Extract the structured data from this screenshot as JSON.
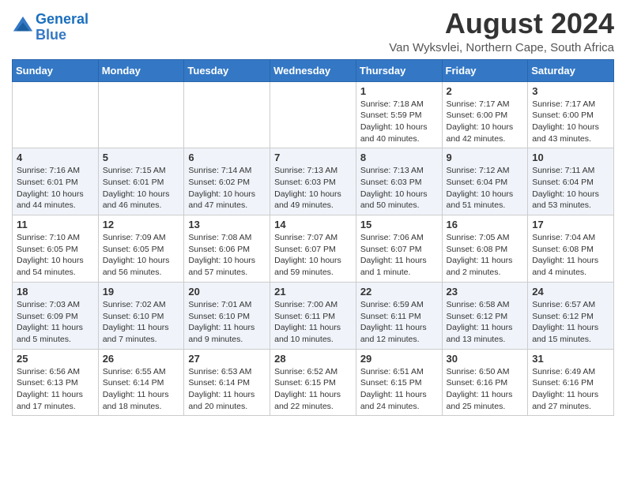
{
  "header": {
    "logo_line1": "General",
    "logo_line2": "Blue",
    "month_year": "August 2024",
    "location": "Van Wyksvlei, Northern Cape, South Africa"
  },
  "weekdays": [
    "Sunday",
    "Monday",
    "Tuesday",
    "Wednesday",
    "Thursday",
    "Friday",
    "Saturday"
  ],
  "weeks": [
    [
      {
        "day": "",
        "info": ""
      },
      {
        "day": "",
        "info": ""
      },
      {
        "day": "",
        "info": ""
      },
      {
        "day": "",
        "info": ""
      },
      {
        "day": "1",
        "info": "Sunrise: 7:18 AM\nSunset: 5:59 PM\nDaylight: 10 hours\nand 40 minutes."
      },
      {
        "day": "2",
        "info": "Sunrise: 7:17 AM\nSunset: 6:00 PM\nDaylight: 10 hours\nand 42 minutes."
      },
      {
        "day": "3",
        "info": "Sunrise: 7:17 AM\nSunset: 6:00 PM\nDaylight: 10 hours\nand 43 minutes."
      }
    ],
    [
      {
        "day": "4",
        "info": "Sunrise: 7:16 AM\nSunset: 6:01 PM\nDaylight: 10 hours\nand 44 minutes."
      },
      {
        "day": "5",
        "info": "Sunrise: 7:15 AM\nSunset: 6:01 PM\nDaylight: 10 hours\nand 46 minutes."
      },
      {
        "day": "6",
        "info": "Sunrise: 7:14 AM\nSunset: 6:02 PM\nDaylight: 10 hours\nand 47 minutes."
      },
      {
        "day": "7",
        "info": "Sunrise: 7:13 AM\nSunset: 6:03 PM\nDaylight: 10 hours\nand 49 minutes."
      },
      {
        "day": "8",
        "info": "Sunrise: 7:13 AM\nSunset: 6:03 PM\nDaylight: 10 hours\nand 50 minutes."
      },
      {
        "day": "9",
        "info": "Sunrise: 7:12 AM\nSunset: 6:04 PM\nDaylight: 10 hours\nand 51 minutes."
      },
      {
        "day": "10",
        "info": "Sunrise: 7:11 AM\nSunset: 6:04 PM\nDaylight: 10 hours\nand 53 minutes."
      }
    ],
    [
      {
        "day": "11",
        "info": "Sunrise: 7:10 AM\nSunset: 6:05 PM\nDaylight: 10 hours\nand 54 minutes."
      },
      {
        "day": "12",
        "info": "Sunrise: 7:09 AM\nSunset: 6:05 PM\nDaylight: 10 hours\nand 56 minutes."
      },
      {
        "day": "13",
        "info": "Sunrise: 7:08 AM\nSunset: 6:06 PM\nDaylight: 10 hours\nand 57 minutes."
      },
      {
        "day": "14",
        "info": "Sunrise: 7:07 AM\nSunset: 6:07 PM\nDaylight: 10 hours\nand 59 minutes."
      },
      {
        "day": "15",
        "info": "Sunrise: 7:06 AM\nSunset: 6:07 PM\nDaylight: 11 hours\nand 1 minute."
      },
      {
        "day": "16",
        "info": "Sunrise: 7:05 AM\nSunset: 6:08 PM\nDaylight: 11 hours\nand 2 minutes."
      },
      {
        "day": "17",
        "info": "Sunrise: 7:04 AM\nSunset: 6:08 PM\nDaylight: 11 hours\nand 4 minutes."
      }
    ],
    [
      {
        "day": "18",
        "info": "Sunrise: 7:03 AM\nSunset: 6:09 PM\nDaylight: 11 hours\nand 5 minutes."
      },
      {
        "day": "19",
        "info": "Sunrise: 7:02 AM\nSunset: 6:10 PM\nDaylight: 11 hours\nand 7 minutes."
      },
      {
        "day": "20",
        "info": "Sunrise: 7:01 AM\nSunset: 6:10 PM\nDaylight: 11 hours\nand 9 minutes."
      },
      {
        "day": "21",
        "info": "Sunrise: 7:00 AM\nSunset: 6:11 PM\nDaylight: 11 hours\nand 10 minutes."
      },
      {
        "day": "22",
        "info": "Sunrise: 6:59 AM\nSunset: 6:11 PM\nDaylight: 11 hours\nand 12 minutes."
      },
      {
        "day": "23",
        "info": "Sunrise: 6:58 AM\nSunset: 6:12 PM\nDaylight: 11 hours\nand 13 minutes."
      },
      {
        "day": "24",
        "info": "Sunrise: 6:57 AM\nSunset: 6:12 PM\nDaylight: 11 hours\nand 15 minutes."
      }
    ],
    [
      {
        "day": "25",
        "info": "Sunrise: 6:56 AM\nSunset: 6:13 PM\nDaylight: 11 hours\nand 17 minutes."
      },
      {
        "day": "26",
        "info": "Sunrise: 6:55 AM\nSunset: 6:14 PM\nDaylight: 11 hours\nand 18 minutes."
      },
      {
        "day": "27",
        "info": "Sunrise: 6:53 AM\nSunset: 6:14 PM\nDaylight: 11 hours\nand 20 minutes."
      },
      {
        "day": "28",
        "info": "Sunrise: 6:52 AM\nSunset: 6:15 PM\nDaylight: 11 hours\nand 22 minutes."
      },
      {
        "day": "29",
        "info": "Sunrise: 6:51 AM\nSunset: 6:15 PM\nDaylight: 11 hours\nand 24 minutes."
      },
      {
        "day": "30",
        "info": "Sunrise: 6:50 AM\nSunset: 6:16 PM\nDaylight: 11 hours\nand 25 minutes."
      },
      {
        "day": "31",
        "info": "Sunrise: 6:49 AM\nSunset: 6:16 PM\nDaylight: 11 hours\nand 27 minutes."
      }
    ]
  ]
}
